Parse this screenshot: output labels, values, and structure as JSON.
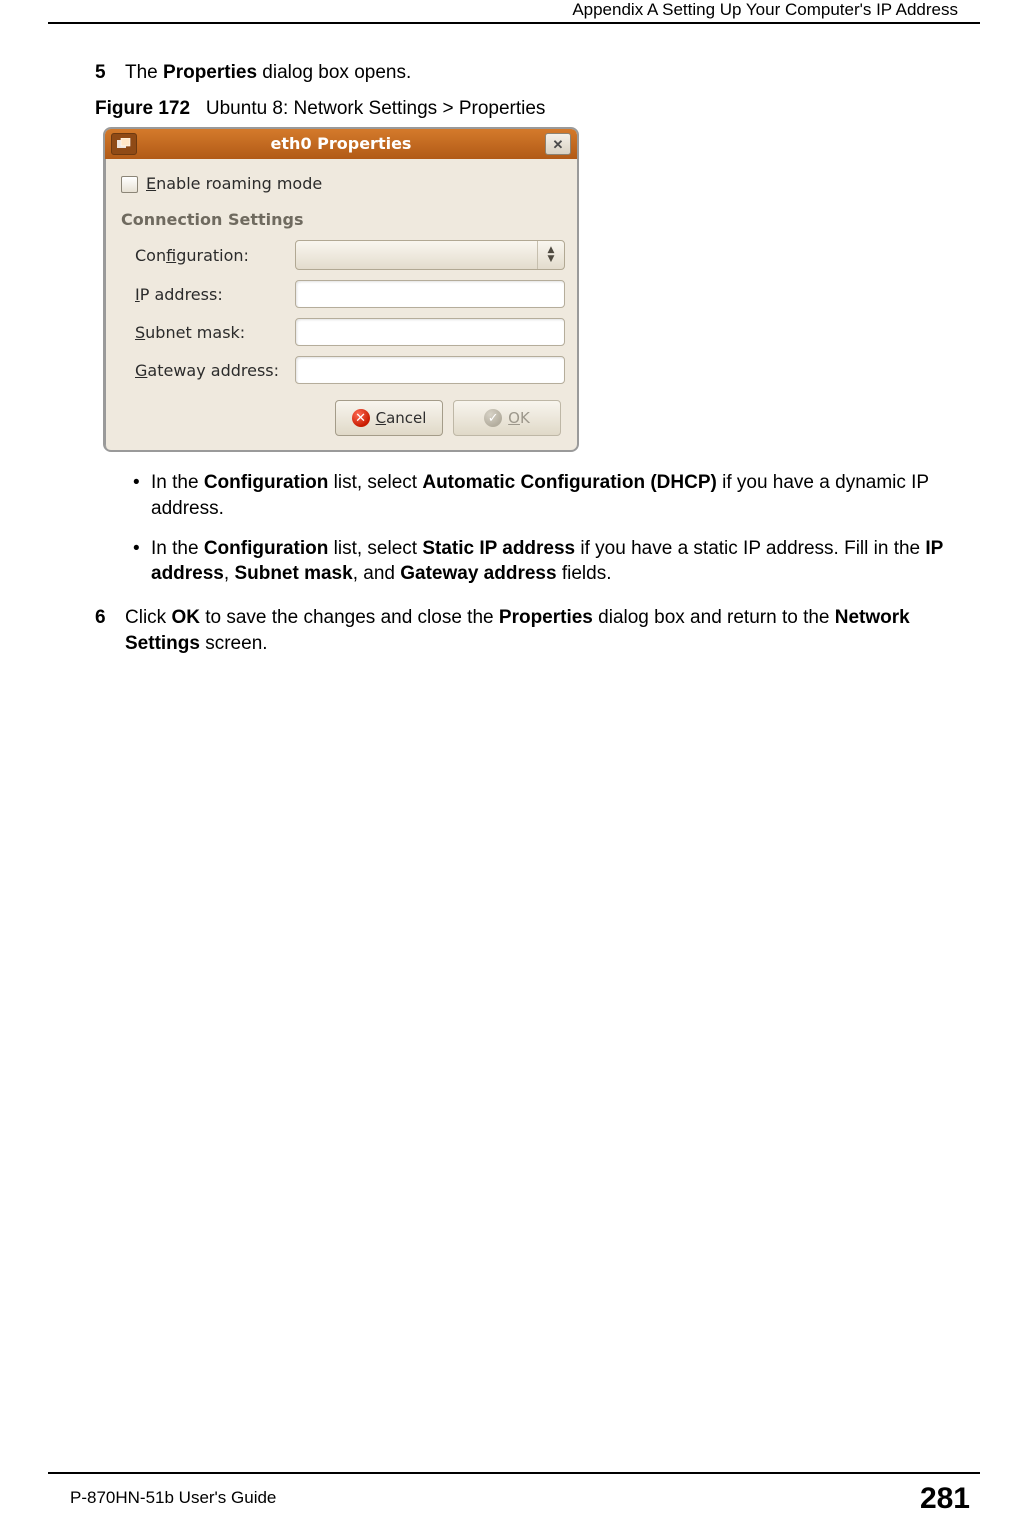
{
  "header": {
    "running_head": "Appendix A Setting Up Your Computer's IP Address"
  },
  "step5": {
    "num": "5",
    "pre": "The ",
    "b1": "Properties",
    "post": " dialog box opens."
  },
  "figure": {
    "num": "Figure 172",
    "caption": "Ubuntu 8: Network Settings > Properties"
  },
  "dialog": {
    "title": "eth0 Properties",
    "close_glyph": "✕",
    "roaming_pre": "E",
    "roaming_rest": "nable roaming mode",
    "section": "Connection Settings",
    "rows": {
      "config_pre": "Con",
      "config_u": "f",
      "config_post": "iguration:",
      "ip_u": "I",
      "ip_post": "P address:",
      "subnet_u": "S",
      "subnet_post": "ubnet mask:",
      "gw_u": "G",
      "gw_post": "ateway address:"
    },
    "cancel_u": "C",
    "cancel_rest": "ancel",
    "ok_u": "O",
    "ok_rest": "K"
  },
  "bullets": {
    "item1": {
      "t1": "In the ",
      "b1": "Configuration",
      "t2": " list, select ",
      "b2": "Automatic Configuration (DHCP)",
      "t3": " if you have a dynamic IP address."
    },
    "item2": {
      "t1": "In the ",
      "b1": "Configuration",
      "t2": " list, select ",
      "b2": "Static IP address",
      "t3": " if you have a static IP address. Fill in the ",
      "b3": "IP address",
      "t4": ", ",
      "b4": "Subnet mask",
      "t5": ", and ",
      "b5": "Gateway address",
      "t6": " fields."
    }
  },
  "step6": {
    "num": "6",
    "t1": "Click ",
    "b1": "OK",
    "t2": " to save the changes and close the ",
    "b2": "Properties",
    "t3": " dialog box and return to the ",
    "b3": "Network Settings",
    "t4": " screen."
  },
  "footer": {
    "guide": "P-870HN-51b User's Guide",
    "page": "281"
  }
}
